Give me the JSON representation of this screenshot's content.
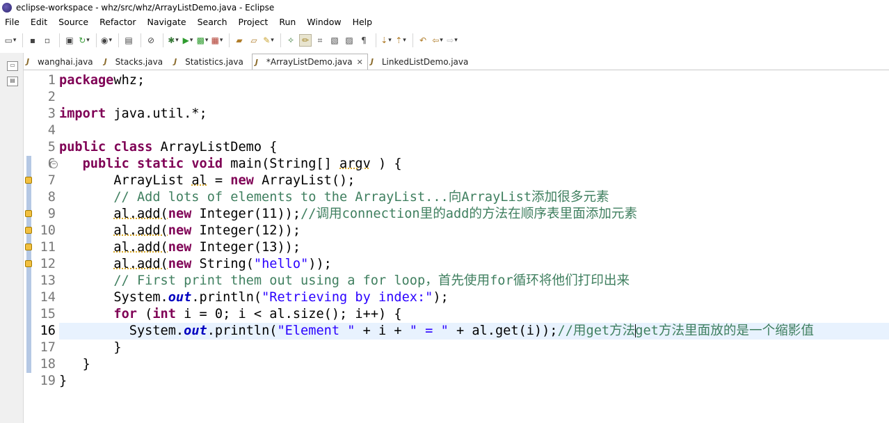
{
  "window": {
    "title": "eclipse-workspace - whz/src/whz/ArrayListDemo.java - Eclipse"
  },
  "menu": [
    "File",
    "Edit",
    "Source",
    "Refactor",
    "Navigate",
    "Search",
    "Project",
    "Run",
    "Window",
    "Help"
  ],
  "tabs": [
    {
      "label": "wanghai.java",
      "active": false
    },
    {
      "label": "Stacks.java",
      "active": false
    },
    {
      "label": "Statistics.java",
      "active": false
    },
    {
      "label": "*ArrayListDemo.java",
      "active": true
    },
    {
      "label": "LinkedListDemo.java",
      "active": false
    }
  ],
  "editor": {
    "current_line": 16,
    "line_numbers": [
      "1",
      "2",
      "3",
      "4",
      "5",
      "6",
      "7",
      "8",
      "9",
      "10",
      "11",
      "12",
      "13",
      "14",
      "15",
      "16",
      "17",
      "18",
      "19"
    ],
    "lines": [
      [
        [
          "kw",
          "package"
        ],
        [
          "",
          "whz;"
        ]
      ],
      [],
      [
        [
          "kw",
          "import"
        ],
        [
          "",
          " java.util.*;"
        ]
      ],
      [],
      [
        [
          "kw",
          "public class"
        ],
        [
          "",
          " ArrayListDemo {"
        ]
      ],
      [
        [
          "",
          " "
        ],
        [
          "kw",
          "public static void"
        ],
        [
          "",
          " main(String[] "
        ],
        [
          "warn",
          "argv"
        ],
        [
          "",
          " ) {"
        ]
      ],
      [
        [
          "",
          "       ArrayList "
        ],
        [
          "warn",
          "al"
        ],
        [
          "",
          " = "
        ],
        [
          "kw",
          "new"
        ],
        [
          "",
          " ArrayList();"
        ]
      ],
      [
        [
          "cm",
          "       // Add lots of elements to the ArrayList...向ArrayList添加很多元素"
        ]
      ],
      [
        [
          "",
          "       "
        ],
        [
          "warn",
          "al.add("
        ],
        [
          "kw",
          "new"
        ],
        [
          "",
          " Integer(11));"
        ],
        [
          "cm",
          "//调用connection里的add的方法在顺序表里面添加元素"
        ]
      ],
      [
        [
          "",
          "       "
        ],
        [
          "warn",
          "al.add("
        ],
        [
          "kw",
          "new"
        ],
        [
          "",
          " Integer(12));"
        ]
      ],
      [
        [
          "",
          "       "
        ],
        [
          "warn",
          "al.add("
        ],
        [
          "kw",
          "new"
        ],
        [
          "",
          " Integer(13));"
        ]
      ],
      [
        [
          "",
          "       "
        ],
        [
          "warn",
          "al.add("
        ],
        [
          "kw",
          "new"
        ],
        [
          "",
          " String("
        ],
        [
          "str",
          "\"hello\""
        ],
        [
          "",
          "));"
        ]
      ],
      [
        [
          "cm",
          "       // First print them out using a for loop，首先使用for循环将他们打印出来"
        ]
      ],
      [
        [
          "",
          "       System."
        ],
        [
          "fld",
          "out"
        ],
        [
          "",
          ".println("
        ],
        [
          "str",
          "\"Retrieving by index:\""
        ],
        [
          "",
          ");"
        ]
      ],
      [
        [
          "",
          "       "
        ],
        [
          "kw",
          "for"
        ],
        [
          "",
          " ("
        ],
        [
          "kw",
          "int"
        ],
        [
          "",
          " i = 0; i < al.size(); i++) {"
        ]
      ],
      [
        [
          "",
          "         System."
        ],
        [
          "fld",
          "out"
        ],
        [
          "",
          ".println("
        ],
        [
          "str",
          "\"Element \""
        ],
        [
          "",
          " + i + "
        ],
        [
          "str",
          "\" = \""
        ],
        [
          "",
          " + al.get(i));"
        ],
        [
          "cm",
          "//用get方法"
        ],
        [
          "caret",
          ""
        ],
        [
          "cm",
          "get方法里面放的是一个缩影值"
        ]
      ],
      [
        [
          "",
          "       }"
        ]
      ],
      [
        [
          "",
          "   }"
        ]
      ],
      [
        [
          "",
          "}"
        ]
      ]
    ]
  },
  "icons": [
    "new-icon",
    "save-icon",
    "save-all-icon",
    "build-icon",
    "refresh-icon",
    "debug-icon",
    "skip-breakpoints-icon",
    "run-icon",
    "external-tools-icon",
    "coverage-icon",
    "open-type-icon",
    "open-task-icon",
    "search-icon",
    "annotation-icon",
    "mark-occurrences-icon",
    "block-selection-icon",
    "show-whitespace-icon",
    "next-annotation-icon",
    "prev-annotation-icon",
    "last-edit-icon",
    "back-icon",
    "forward-icon"
  ]
}
